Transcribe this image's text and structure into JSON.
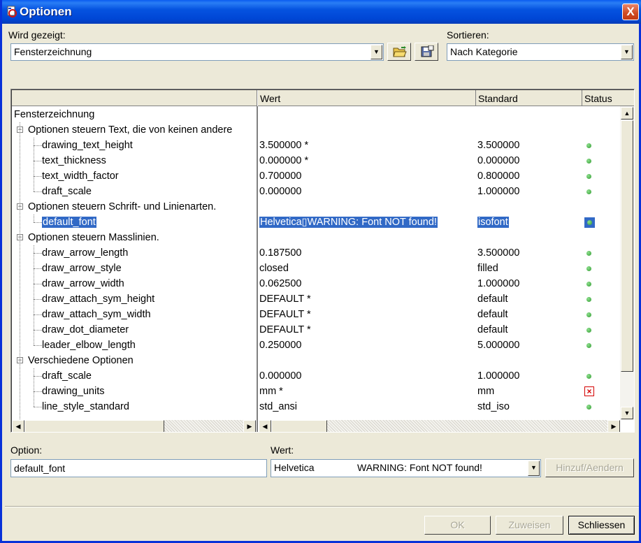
{
  "window": {
    "title": "Optionen",
    "close_label": "X"
  },
  "toolbar": {
    "shown_label": "Wird gezeigt:",
    "shown_value": "Fensterzeichnung",
    "open_icon": "folder-open-icon",
    "save_icon": "save-config-icon",
    "sort_label": "Sortieren:",
    "sort_value": "Nach Kategorie"
  },
  "grid": {
    "columns": [
      "Wert",
      "Standard",
      "Status"
    ],
    "root": "Fensterzeichnung",
    "groups": [
      {
        "label": "Optionen steuern Text, die von keinen andere",
        "rows": [
          {
            "name": "drawing_text_height",
            "value": "3.500000 *",
            "default": "3.500000",
            "status": "ok"
          },
          {
            "name": "text_thickness",
            "value": "0.000000 *",
            "default": "0.000000",
            "status": "ok"
          },
          {
            "name": "text_width_factor",
            "value": "0.700000",
            "default": "0.800000",
            "status": "ok"
          },
          {
            "name": "draft_scale",
            "value": "0.000000",
            "default": "1.000000",
            "status": "ok"
          }
        ]
      },
      {
        "label": "Optionen steuern Schrift- und Linienarten.",
        "rows": [
          {
            "name": "default_font",
            "value": "Helvetica▯WARNING: Font NOT found!",
            "default": "isofont",
            "status": "selected"
          }
        ]
      },
      {
        "label": "Optionen steuern Masslinien.",
        "rows": [
          {
            "name": "draw_arrow_length",
            "value": "0.187500",
            "default": "3.500000",
            "status": "ok"
          },
          {
            "name": "draw_arrow_style",
            "value": "closed",
            "default": "filled",
            "status": "ok"
          },
          {
            "name": "draw_arrow_width",
            "value": "0.062500",
            "default": "1.000000",
            "status": "ok"
          },
          {
            "name": "draw_attach_sym_height",
            "value": "DEFAULT *",
            "default": "default",
            "status": "ok"
          },
          {
            "name": "draw_attach_sym_width",
            "value": "DEFAULT *",
            "default": "default",
            "status": "ok"
          },
          {
            "name": "draw_dot_diameter",
            "value": "DEFAULT *",
            "default": "default",
            "status": "ok"
          },
          {
            "name": "leader_elbow_length",
            "value": "0.250000",
            "default": "5.000000",
            "status": "ok"
          }
        ]
      },
      {
        "label": "Verschiedene Optionen",
        "rows": [
          {
            "name": "draft_scale",
            "value": "0.000000",
            "default": "1.000000",
            "status": "ok"
          },
          {
            "name": "drawing_units",
            "value": "mm *",
            "default": "mm",
            "status": "error"
          },
          {
            "name": "line_style_standard",
            "value": "std_ansi",
            "default": "std_iso",
            "status": "ok"
          }
        ]
      }
    ]
  },
  "editor": {
    "option_label": "Option:",
    "option_value": "default_font",
    "value_label": "Wert:",
    "value_font": "Helvetica",
    "value_warning": "WARNING: Font NOT found!",
    "apply_label": "Hinzuf/Aendern"
  },
  "footer": {
    "ok_label": "OK",
    "assign_label": "Zuweisen",
    "close_label": "Schliessen"
  },
  "colors": {
    "selection": "#3169c6",
    "status_ok": "#2f9a2f",
    "status_error": "#d40000"
  }
}
